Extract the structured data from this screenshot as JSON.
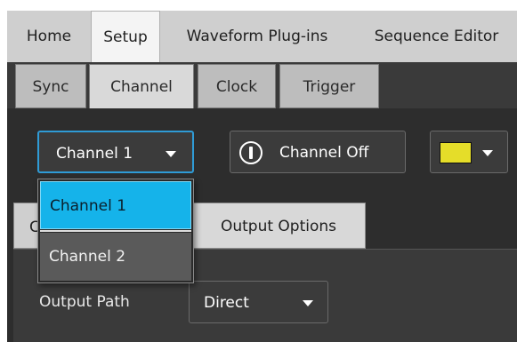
{
  "top_tabs": [
    {
      "label": "Home",
      "active": false
    },
    {
      "label": "Setup",
      "active": true
    },
    {
      "label": "Waveform Plug-ins",
      "active": false
    },
    {
      "label": "Sequence Editor",
      "active": false
    }
  ],
  "sub_tabs": [
    {
      "label": "Sync",
      "active": false
    },
    {
      "label": "Channel",
      "active": true
    },
    {
      "label": "Clock",
      "active": false
    },
    {
      "label": "Trigger",
      "active": false
    }
  ],
  "channel_select": {
    "value": "Channel 1",
    "icon": "chevron-down-icon"
  },
  "channel_power": {
    "label": "Channel Off",
    "icon": "power-icon"
  },
  "color_select": {
    "swatch_color": "#e5dd29",
    "icon": "chevron-down-icon"
  },
  "dropdown": {
    "options": [
      "Channel 1",
      "Channel 2"
    ],
    "selected_index": 0
  },
  "inner_tabs": {
    "hidden_tab_initial": "C",
    "output_options_label": "Output Options"
  },
  "output_path": {
    "label": "Output Path",
    "value": "Direct"
  },
  "colors": {
    "accent": "#15b3ea",
    "focus_border": "#2f9bd6",
    "panel": "#2d2d2d"
  }
}
